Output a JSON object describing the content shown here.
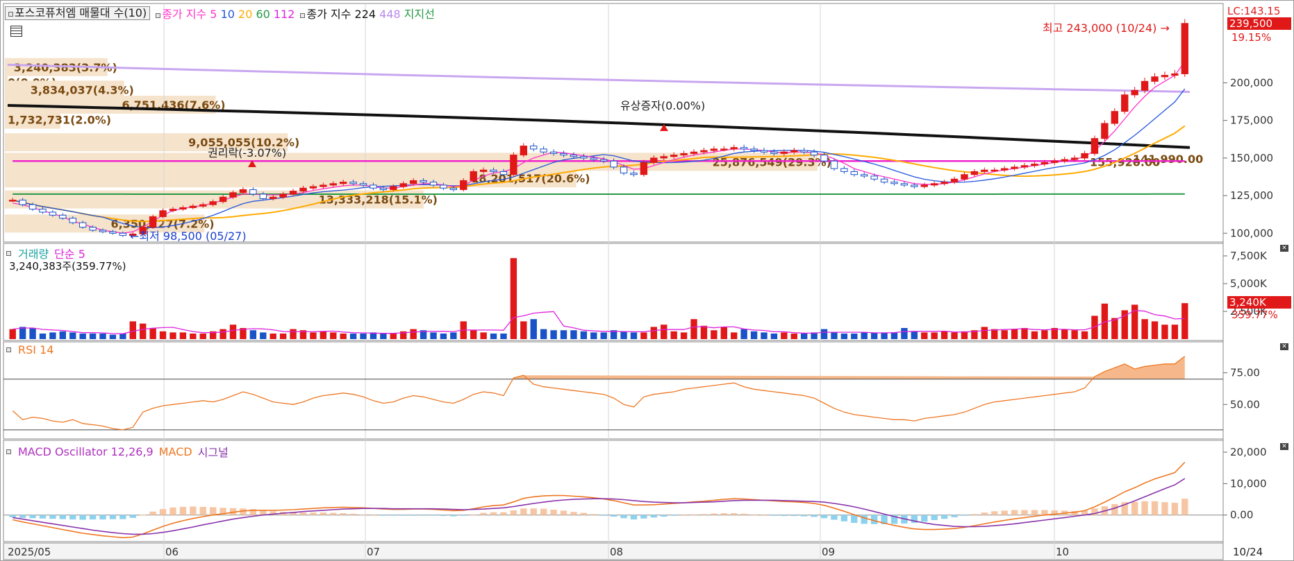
{
  "header": {
    "title": "포스코퓨처엠 매물대 수(10)",
    "ma_label": "종가 지수",
    "ma_periods": [
      "5",
      "10",
      "20",
      "60",
      "112"
    ],
    "ma_colors": [
      "#ff33cc",
      "#2255dd",
      "#ffaa00",
      "#229944",
      "#dd22dd"
    ],
    "ma2_label": "종가 지수 224",
    "ma2_extra": "448",
    "support_label": "지지선"
  },
  "top_right": {
    "lc_label": "LC:143.15",
    "current_price": "239,500",
    "change_pct": "19.15%"
  },
  "price_axis": {
    "ticks": [
      {
        "label": "200,000",
        "value": 200000
      },
      {
        "label": "175,000",
        "value": 175000
      },
      {
        "label": "150,000",
        "value": 150000
      },
      {
        "label": "125,000",
        "value": 125000
      },
      {
        "label": "100,000",
        "value": 100000
      }
    ]
  },
  "annotations": {
    "high": "최고 243,000 (10/24)",
    "low": "최저 98,500 (05/27)",
    "rights_ex": "권리락(-3.07%)",
    "capital_increase": "유상증자(0.00%)",
    "profile_extra": "155,920.00",
    "profile_extra2": "141,990.00"
  },
  "volume_profile": [
    {
      "label": "3,240,383(3.7%)",
      "price": 210000
    },
    {
      "label": "0(0.0%)",
      "price": 200000
    },
    {
      "label": "3,834,037(4.3%)",
      "price": 195000
    },
    {
      "label": "6,751,436(7.6%)",
      "price": 185000
    },
    {
      "label": "1,732,731(2.0%)",
      "price": 175000
    },
    {
      "label": "9,055,055(10.2%)",
      "price": 160000
    },
    {
      "label": "25,876,549(29.3%)",
      "price": 147000
    },
    {
      "label": "18,201,517(20.6%)",
      "price": 136000
    },
    {
      "label": "13,333,218(15.1%)",
      "price": 122000
    },
    {
      "label": "6,350,727(7.2%)",
      "price": 106000
    }
  ],
  "volume_pane": {
    "label": "거래량",
    "ma_label": "단순 5",
    "info": "3,240,383주(359.77%)",
    "badge_value": "3,240K",
    "badge_pct": "359.77%",
    "ticks": [
      "7,500K",
      "5,000K",
      "2,500K"
    ]
  },
  "rsi_pane": {
    "label": "RSI 14",
    "ticks": [
      "75.00",
      "50.00"
    ]
  },
  "macd_pane": {
    "label": "MACD Oscillator 12,26,9",
    "macd_label": "MACD",
    "signal_label": "시그널",
    "ticks": [
      "20,000",
      "10,000",
      "0.00"
    ]
  },
  "time_axis": {
    "labels": [
      "2025/05",
      "06",
      "07",
      "08",
      "09",
      "10"
    ],
    "end_label": "10/24"
  },
  "chart_data": {
    "type": "line",
    "title": "포스코퓨처엠",
    "price": {
      "ylim": [
        96000,
        250000
      ],
      "close": [
        122000,
        119000,
        116000,
        114000,
        112000,
        110000,
        107000,
        104000,
        102000,
        101000,
        100000,
        98500,
        99500,
        104000,
        111000,
        115000,
        116000,
        117000,
        118000,
        119000,
        121000,
        124000,
        127000,
        129000,
        126000,
        123000,
        124000,
        126000,
        128000,
        130000,
        131000,
        132000,
        133000,
        134000,
        133000,
        132000,
        130000,
        129000,
        131000,
        133000,
        135000,
        134000,
        132000,
        130000,
        129000,
        135000,
        141000,
        142000,
        141000,
        139000,
        152000,
        158000,
        156000,
        154000,
        153000,
        152000,
        151000,
        150000,
        149000,
        148000,
        144000,
        140000,
        139000,
        147000,
        150000,
        151000,
        152000,
        153000,
        154000,
        155000,
        156000,
        156000,
        157000,
        156000,
        155000,
        154000,
        153000,
        154000,
        155000,
        154000,
        152000,
        148000,
        143000,
        141000,
        139000,
        138000,
        136000,
        134000,
        133000,
        132000,
        131000,
        132000,
        133000,
        134000,
        136000,
        139000,
        141000,
        142000,
        142000,
        143000,
        144000,
        145000,
        146000,
        147000,
        148000,
        149000,
        150000,
        153000,
        163000,
        173000,
        181000,
        192000,
        195000,
        201000,
        204000,
        205000,
        206000,
        239500
      ],
      "ma5": [
        120000,
        119000,
        117000,
        115000,
        113000,
        111000,
        108000,
        106000,
        104000,
        102000,
        101000,
        100000,
        101000,
        104000,
        108000,
        112000,
        115000,
        116500,
        117500,
        118500,
        120000,
        122000,
        124000,
        126000,
        126000,
        125500,
        125500,
        125500,
        126000,
        127000,
        128500,
        129500,
        130500,
        131500,
        132000,
        132000,
        131000,
        130000,
        130000,
        131000,
        132000,
        133000,
        133000,
        132000,
        131000,
        132000,
        135000,
        138000,
        140000,
        141000,
        143000,
        147000,
        150000,
        152000,
        154000,
        153500,
        152500,
        151500,
        150500,
        149500,
        147500,
        145000,
        142500,
        143000,
        145000,
        147000,
        149000,
        150500,
        152000,
        153000,
        154000,
        155000,
        156000,
        156000,
        155500,
        155000,
        154000,
        153500,
        154000,
        154000,
        153500,
        152000,
        149500,
        146500,
        143000,
        141000,
        139000,
        137500,
        136000,
        134500,
        133000,
        132500,
        132500,
        133000,
        134000,
        135500,
        137500,
        139500,
        141000,
        142000,
        143000,
        144000,
        145000,
        146000,
        147000,
        148000,
        149000,
        151000,
        155000,
        161000,
        168000,
        176000,
        184000,
        191000,
        197000,
        201000,
        205000,
        214000
      ]
    },
    "volume": {
      "ylim": [
        0,
        8000000
      ],
      "values": [
        900000,
        1100000,
        1000000,
        500000,
        600000,
        700000,
        600000,
        500000,
        500000,
        500000,
        400000,
        500000,
        1600000,
        1400000,
        1000000,
        700000,
        600000,
        600000,
        500000,
        500000,
        700000,
        900000,
        1300000,
        1000000,
        800000,
        600000,
        500000,
        500000,
        900000,
        800000,
        600000,
        700000,
        600000,
        500000,
        500000,
        500000,
        600000,
        500000,
        500000,
        700000,
        900000,
        800000,
        600000,
        500000,
        600000,
        1600000,
        800000,
        600000,
        500000,
        500000,
        7300000,
        1600000,
        1800000,
        900000,
        800000,
        800000,
        800000,
        700000,
        600000,
        600000,
        800000,
        700000,
        600000,
        600000,
        1100000,
        1300000,
        700000,
        600000,
        1800000,
        1200000,
        800000,
        1100000,
        600000,
        900000,
        700000,
        600000,
        500000,
        600000,
        500000,
        500000,
        600000,
        900000,
        600000,
        500000,
        500000,
        600000,
        600000,
        600000,
        600000,
        1000000,
        700000,
        600000,
        600000,
        700000,
        600000,
        700000,
        800000,
        1100000,
        900000,
        800000,
        900000,
        1000000,
        700000,
        800000,
        1000000,
        900000,
        800000,
        700000,
        2100000,
        3200000,
        1900000,
        2600000,
        3100000,
        1800000,
        1600000,
        1300000,
        1300000,
        3240383
      ]
    },
    "rsi": {
      "ylim": [
        25,
        95
      ],
      "values": [
        45,
        38,
        40,
        39,
        37,
        36,
        38,
        35,
        34,
        33,
        31,
        30,
        32,
        44,
        47,
        49,
        50,
        51,
        52,
        53,
        52,
        54,
        57,
        60,
        58,
        55,
        52,
        51,
        50,
        52,
        55,
        57,
        58,
        59,
        58,
        56,
        53,
        51,
        52,
        55,
        57,
        56,
        54,
        52,
        51,
        54,
        58,
        60,
        59,
        57,
        71,
        73,
        66,
        64,
        63,
        62,
        61,
        60,
        59,
        58,
        55,
        50,
        48,
        56,
        58,
        59,
        60,
        62,
        63,
        64,
        65,
        66,
        67,
        64,
        62,
        61,
        60,
        59,
        58,
        57,
        55,
        51,
        47,
        44,
        42,
        41,
        40,
        39,
        38,
        38,
        37,
        39,
        40,
        41,
        42,
        44,
        47,
        50,
        52,
        53,
        54,
        55,
        56,
        57,
        58,
        59,
        60,
        63,
        72,
        76,
        79,
        82,
        78,
        80,
        81,
        82,
        82,
        88
      ]
    },
    "macd": {
      "ylim": [
        -8000,
        22000
      ],
      "macd": [
        -1500,
        -2200,
        -2800,
        -3400,
        -4000,
        -4600,
        -5200,
        -5800,
        -6200,
        -6600,
        -6900,
        -7200,
        -7000,
        -6000,
        -4800,
        -3600,
        -2600,
        -1800,
        -1100,
        -500,
        0,
        400,
        900,
        1300,
        1500,
        1500,
        1500,
        1600,
        1700,
        1900,
        2100,
        2300,
        2400,
        2500,
        2400,
        2300,
        2100,
        1900,
        1800,
        1800,
        1900,
        1900,
        1800,
        1600,
        1400,
        1500,
        2000,
        2600,
        3000,
        3200,
        4200,
        5300,
        5800,
        6100,
        6200,
        6200,
        6000,
        5800,
        5500,
        5100,
        4600,
        3900,
        3200,
        3200,
        3300,
        3500,
        3700,
        3900,
        4200,
        4400,
        4700,
        5000,
        5200,
        5100,
        4900,
        4700,
        4500,
        4300,
        4200,
        4000,
        3700,
        3100,
        2200,
        1200,
        100,
        -900,
        -1800,
        -2600,
        -3300,
        -3900,
        -4400,
        -4600,
        -4600,
        -4500,
        -4300,
        -3900,
        -3400,
        -2800,
        -2200,
        -1700,
        -1200,
        -800,
        -400,
        0,
        300,
        600,
        900,
        1400,
        2600,
        4100,
        5700,
        7400,
        8700,
        10200,
        11500,
        12500,
        13500,
        16800
      ],
      "signal": [
        -800,
        -1300,
        -1800,
        -2300,
        -2800,
        -3300,
        -3800,
        -4300,
        -4800,
        -5200,
        -5600,
        -5900,
        -6100,
        -6100,
        -5900,
        -5500,
        -5000,
        -4400,
        -3800,
        -3100,
        -2500,
        -1900,
        -1300,
        -800,
        -400,
        0,
        300,
        600,
        800,
        1100,
        1300,
        1500,
        1700,
        1900,
        2000,
        2100,
        2100,
        2100,
        2000,
        2000,
        2000,
        2000,
        2000,
        1900,
        1800,
        1700,
        1800,
        1900,
        2100,
        2300,
        2700,
        3200,
        3700,
        4100,
        4500,
        4800,
        5000,
        5100,
        5200,
        5200,
        5100,
        4900,
        4600,
        4300,
        4100,
        4000,
        3900,
        3900,
        4000,
        4100,
        4200,
        4400,
        4600,
        4700,
        4700,
        4700,
        4700,
        4600,
        4500,
        4400,
        4300,
        4100,
        3700,
        3200,
        2600,
        1900,
        1100,
        300,
        -500,
        -1200,
        -1900,
        -2500,
        -3000,
        -3300,
        -3600,
        -3700,
        -3700,
        -3600,
        -3400,
        -3100,
        -2800,
        -2400,
        -2000,
        -1600,
        -1200,
        -800,
        -400,
        0,
        500,
        1300,
        2200,
        3300,
        4500,
        5800,
        7100,
        8400,
        9600,
        11600
      ],
      "osc": [
        -700,
        -900,
        -1000,
        -1100,
        -1200,
        -1300,
        -1400,
        -1500,
        -1400,
        -1400,
        -1300,
        -1300,
        -900,
        100,
        1100,
        1900,
        2400,
        2600,
        2700,
        2600,
        2500,
        2300,
        2200,
        2100,
        1900,
        1500,
        1200,
        1000,
        900,
        800,
        800,
        800,
        700,
        600,
        400,
        200,
        0,
        -200,
        -200,
        -200,
        -100,
        -100,
        -200,
        -300,
        -400,
        -200,
        200,
        700,
        900,
        900,
        1500,
        2100,
        2100,
        2000,
        1700,
        1400,
        1000,
        700,
        300,
        -100,
        -500,
        -1000,
        -1400,
        -1100,
        -800,
        -500,
        -200,
        0,
        200,
        300,
        500,
        600,
        600,
        400,
        200,
        0,
        -200,
        -300,
        -300,
        -400,
        -600,
        -1000,
        -1500,
        -2000,
        -2500,
        -2800,
        -2900,
        -2900,
        -2800,
        -2700,
        -2500,
        -2100,
        -1600,
        -1200,
        -700,
        -200,
        300,
        800,
        1200,
        1400,
        1600,
        1600,
        1600,
        1600,
        1500,
        1400,
        1300,
        1400,
        2100,
        2800,
        3500,
        4100,
        4200,
        4400,
        4400,
        4100,
        3900,
        5200
      ]
    }
  }
}
